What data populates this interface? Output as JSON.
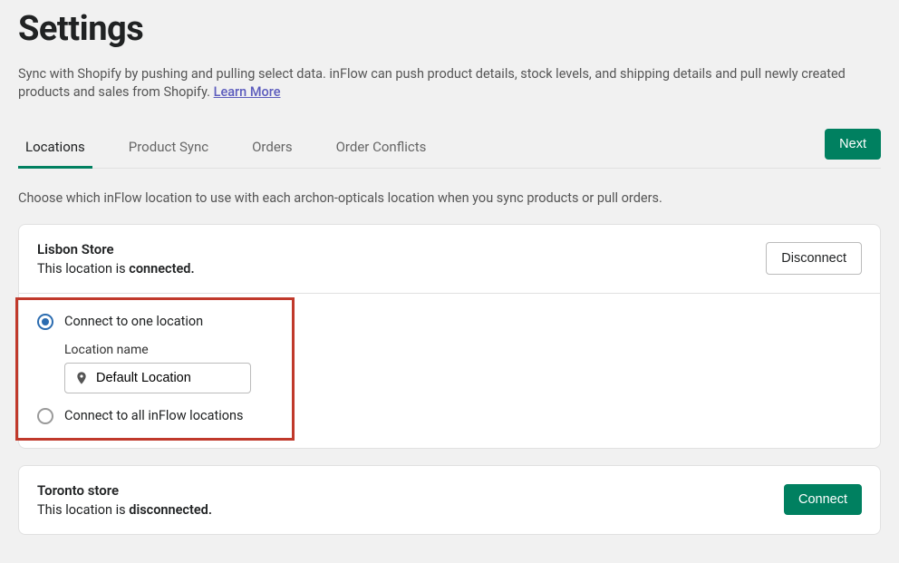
{
  "page": {
    "title": "Settings",
    "description": "Sync with Shopify by pushing and pulling select data. inFlow can push product details, stock levels, and shipping details and pull newly created products and sales from Shopify. ",
    "learn_more": "Learn More"
  },
  "tabs": {
    "items": [
      {
        "label": "Locations",
        "active": true
      },
      {
        "label": "Product Sync",
        "active": false
      },
      {
        "label": "Orders",
        "active": false
      },
      {
        "label": "Order Conflicts",
        "active": false
      }
    ],
    "next_button": "Next"
  },
  "subheading": "Choose which inFlow location to use with each archon-opticals location when you sync products or pull orders.",
  "stores": [
    {
      "name": "Lisbon Store",
      "status_prefix": "This location is ",
      "status_word": "connected.",
      "action_button": "Disconnect",
      "action_primary": false,
      "expanded": true,
      "config": {
        "option_one": "Connect to one location",
        "option_all": "Connect to all inFlow locations",
        "selected": "one",
        "location_label": "Location name",
        "location_value": "Default Location"
      }
    },
    {
      "name": "Toronto store",
      "status_prefix": "This location is ",
      "status_word": "disconnected.",
      "action_button": "Connect",
      "action_primary": true,
      "expanded": false
    }
  ]
}
